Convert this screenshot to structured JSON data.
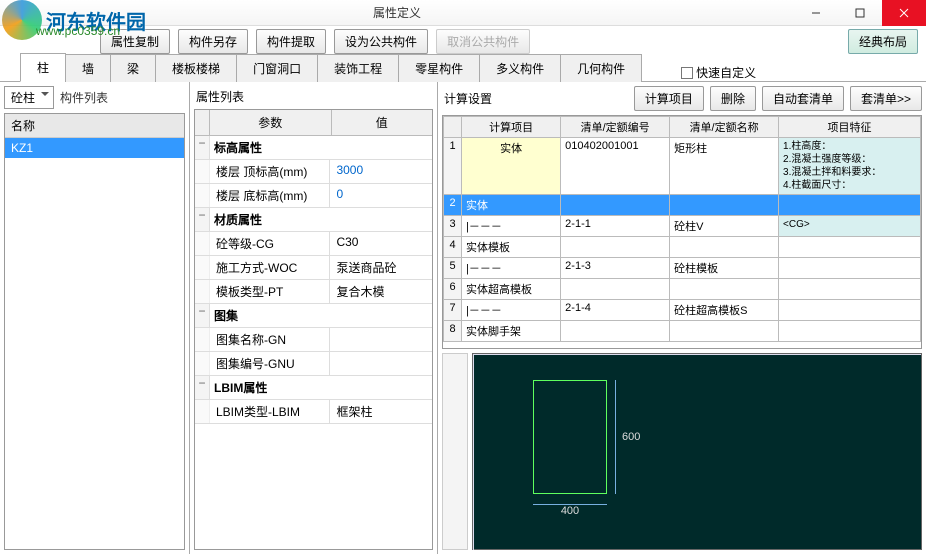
{
  "window": {
    "title": "属性定义"
  },
  "watermark": {
    "text": "河东软件园",
    "url": "www.pc0359.cn"
  },
  "toolbar": {
    "copy_attr": "属性复制",
    "save_component": "构件另存",
    "extract_component": "构件提取",
    "set_public": "设为公共构件",
    "cancel_public": "取消公共构件",
    "classic_layout": "经典布局"
  },
  "tabs": {
    "items": [
      "柱",
      "墙",
      "梁",
      "楼板楼梯",
      "门窗洞口",
      "装饰工程",
      "零星构件",
      "多义构件",
      "几何构件"
    ],
    "active_index": 0,
    "quick_custom": "快速自定义"
  },
  "left": {
    "combo_value": "砼柱",
    "list_label": "构件列表",
    "column_header": "名称",
    "items": [
      "KZ1"
    ],
    "selected_index": 0
  },
  "props": {
    "title": "属性列表",
    "head_param": "参数",
    "head_value": "值",
    "groups": [
      {
        "name": "标高属性",
        "rows": [
          {
            "n": "楼层 顶标高(mm)",
            "v": "3000",
            "blue": true
          },
          {
            "n": "楼层 底标高(mm)",
            "v": "0",
            "blue": true
          }
        ]
      },
      {
        "name": "材质属性",
        "rows": [
          {
            "n": "砼等级-CG",
            "v": "C30"
          },
          {
            "n": "施工方式-WOC",
            "v": "泵送商品砼"
          },
          {
            "n": "模板类型-PT",
            "v": "复合木模"
          }
        ]
      },
      {
        "name": "图集",
        "rows": [
          {
            "n": "图集名称-GN",
            "v": ""
          },
          {
            "n": "图集编号-GNU",
            "v": ""
          }
        ]
      },
      {
        "name": "LBIM属性",
        "rows": [
          {
            "n": "LBIM类型-LBIM",
            "v": "框架柱"
          }
        ]
      }
    ]
  },
  "calc": {
    "title": "计算设置",
    "btns": {
      "calc_item": "计算项目",
      "delete": "删除",
      "auto_bill": "自动套清单",
      "bill": "套清单>>"
    },
    "columns": [
      "",
      "计算项目",
      "清单/定额编号",
      "清单/定额名称",
      "项目特征"
    ],
    "rows": [
      {
        "idx": "1",
        "proj": "实体",
        "proj_bg": true,
        "code": "010402001001",
        "name": "矩形柱",
        "feat": "1.柱高度：\n2.混凝土强度等级：\n3.混凝土拌和料要求：\n4.柱截面尺寸："
      },
      {
        "idx": "2",
        "proj": "实体",
        "sel": true
      },
      {
        "idx": "3",
        "proj": "|－－－",
        "code": "2-1-1",
        "name": "砼柱V",
        "feat": "<CG>"
      },
      {
        "idx": "4",
        "proj": "实体模板"
      },
      {
        "idx": "5",
        "proj": "|－－－",
        "code": "2-1-3",
        "name": "砼柱模板"
      },
      {
        "idx": "6",
        "proj": "实体超高模板"
      },
      {
        "idx": "7",
        "proj": "|－－－",
        "code": "2-1-4",
        "name": "砼柱超高模板S"
      },
      {
        "idx": "8",
        "proj": "实体脚手架"
      }
    ]
  },
  "preview": {
    "width_label": "400",
    "height_label": "600"
  }
}
